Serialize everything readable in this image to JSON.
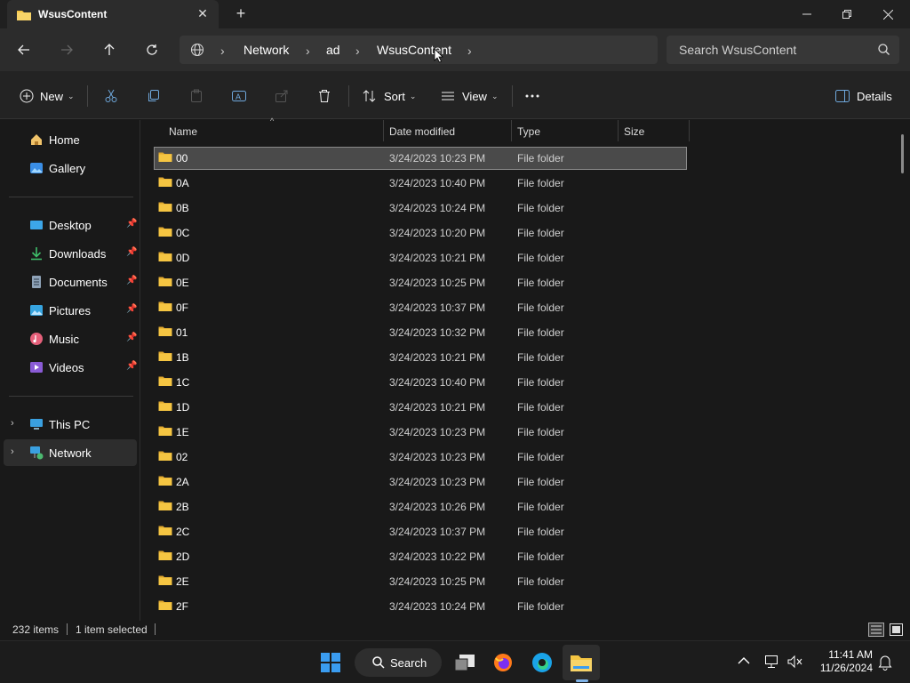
{
  "window": {
    "tab_title": "WsusContent"
  },
  "address": {
    "breadcrumbs": [
      "Network",
      "ad",
      "WsusContent"
    ],
    "search_placeholder": "Search WsusContent"
  },
  "commands": {
    "new_label": "New",
    "sort_label": "Sort",
    "view_label": "View",
    "details_label": "Details"
  },
  "sidebar": {
    "top": [
      {
        "label": "Home",
        "icon": "home-icon"
      },
      {
        "label": "Gallery",
        "icon": "gallery-icon"
      }
    ],
    "quick_access": [
      {
        "label": "Desktop",
        "icon": "desktop-icon"
      },
      {
        "label": "Downloads",
        "icon": "downloads-icon"
      },
      {
        "label": "Documents",
        "icon": "documents-icon"
      },
      {
        "label": "Pictures",
        "icon": "pictures-icon"
      },
      {
        "label": "Music",
        "icon": "music-icon"
      },
      {
        "label": "Videos",
        "icon": "videos-icon"
      }
    ],
    "drives": [
      {
        "label": "This PC",
        "icon": "this-pc-icon"
      },
      {
        "label": "Network",
        "icon": "network-icon"
      }
    ]
  },
  "filelist": {
    "columns": [
      "Name",
      "Date modified",
      "Type",
      "Size"
    ],
    "rows": [
      {
        "name": "00",
        "date": "3/24/2023 10:23 PM",
        "type": "File folder"
      },
      {
        "name": "0A",
        "date": "3/24/2023 10:40 PM",
        "type": "File folder"
      },
      {
        "name": "0B",
        "date": "3/24/2023 10:24 PM",
        "type": "File folder"
      },
      {
        "name": "0C",
        "date": "3/24/2023 10:20 PM",
        "type": "File folder"
      },
      {
        "name": "0D",
        "date": "3/24/2023 10:21 PM",
        "type": "File folder"
      },
      {
        "name": "0E",
        "date": "3/24/2023 10:25 PM",
        "type": "File folder"
      },
      {
        "name": "0F",
        "date": "3/24/2023 10:37 PM",
        "type": "File folder"
      },
      {
        "name": "01",
        "date": "3/24/2023 10:32 PM",
        "type": "File folder"
      },
      {
        "name": "1B",
        "date": "3/24/2023 10:21 PM",
        "type": "File folder"
      },
      {
        "name": "1C",
        "date": "3/24/2023 10:40 PM",
        "type": "File folder"
      },
      {
        "name": "1D",
        "date": "3/24/2023 10:21 PM",
        "type": "File folder"
      },
      {
        "name": "1E",
        "date": "3/24/2023 10:23 PM",
        "type": "File folder"
      },
      {
        "name": "02",
        "date": "3/24/2023 10:23 PM",
        "type": "File folder"
      },
      {
        "name": "2A",
        "date": "3/24/2023 10:23 PM",
        "type": "File folder"
      },
      {
        "name": "2B",
        "date": "3/24/2023 10:26 PM",
        "type": "File folder"
      },
      {
        "name": "2C",
        "date": "3/24/2023 10:37 PM",
        "type": "File folder"
      },
      {
        "name": "2D",
        "date": "3/24/2023 10:22 PM",
        "type": "File folder"
      },
      {
        "name": "2E",
        "date": "3/24/2023 10:25 PM",
        "type": "File folder"
      },
      {
        "name": "2F",
        "date": "3/24/2023 10:24 PM",
        "type": "File folder"
      }
    ],
    "selected_index": 0
  },
  "status": {
    "item_count": "232 items",
    "selection": "1 item selected"
  },
  "taskbar": {
    "search_label": "Search",
    "time": "11:41 AM",
    "date": "11/26/2024"
  },
  "colors": {
    "folder": "#f5c542",
    "accent": "#7fb3e8"
  }
}
